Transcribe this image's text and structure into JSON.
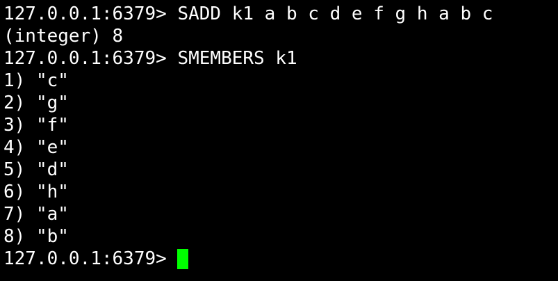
{
  "terminal": {
    "lines": [
      "127.0.0.1:6379> SADD k1 a b c d e f g h a b c",
      "(integer) 8",
      "127.0.0.1:6379> SMEMBERS k1",
      "1) \"c\"",
      "2) \"g\"",
      "3) \"f\"",
      "4) \"e\"",
      "5) \"d\"",
      "6) \"h\"",
      "7) \"a\"",
      "8) \"b\""
    ],
    "prompt": "127.0.0.1:6379>",
    "cursor_color": "#00ff00",
    "background_color": "#000000",
    "text_color": "#ffffff"
  }
}
